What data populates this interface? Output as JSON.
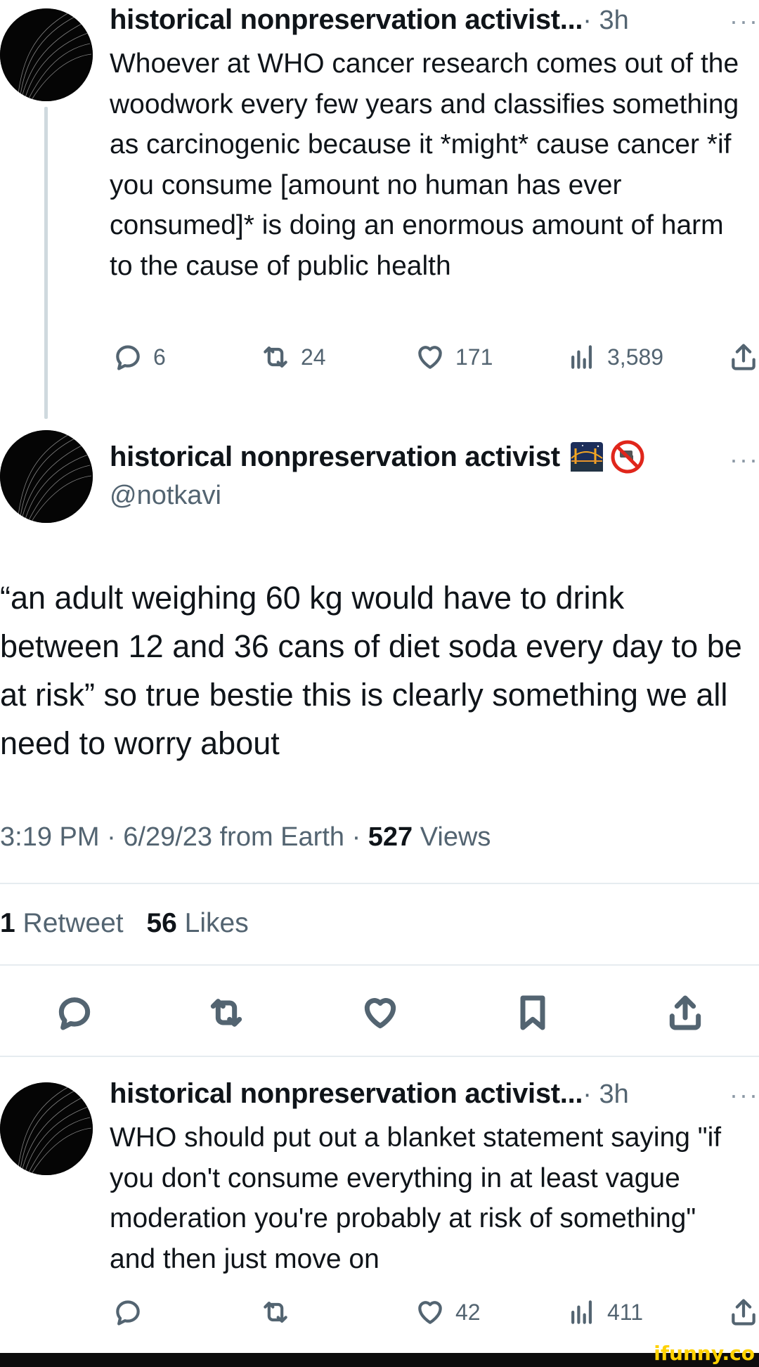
{
  "tweet1": {
    "name": "historical nonpreservation activist...",
    "meta": " · 3h",
    "more": "···",
    "text": "Whoever at WHO cancer research comes out of the woodwork every few years and classifies something as carcinogenic because it *might* cause cancer *if you consume [amount no human has ever consumed]* is doing an enormous amount of harm to the cause of public health",
    "replies": "6",
    "retweets": "24",
    "likes": "171",
    "views": "3,589"
  },
  "main": {
    "name": "historical nonpreservation activist",
    "handle": "@notkavi",
    "more": "···",
    "text": "“an adult weighing 60 kg would have to drink between 12 and 36 cans of diet soda every day to be at risk” so true bestie this is clearly something we all need to worry about",
    "timestamp": "3:19 PM · 6/29/23 from Earth · ",
    "views_count": "527",
    "views_label": " Views",
    "retweet_count": "1",
    "retweet_label": " Retweet",
    "likes_count": "56",
    "likes_label": " Likes"
  },
  "tweet3": {
    "name": "historical nonpreservation activist...",
    "meta": " · 3h",
    "more": "···",
    "text": "WHO should put out a blanket statement saying \"if you don't consume everything in at least vague moderation you're probably at risk of something\" and then just move on",
    "likes": "42",
    "views": "411"
  },
  "watermark": "ifunny.co",
  "colors": {
    "text": "#0f1419",
    "secondary": "#536471",
    "divider": "#e6ecf0",
    "watermark": "#ffd200"
  }
}
